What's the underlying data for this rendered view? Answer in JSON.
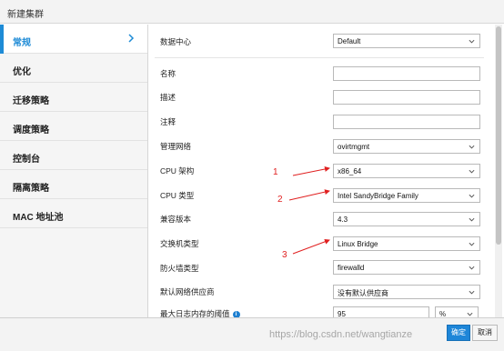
{
  "dialog": {
    "title": "新建集群"
  },
  "sidebar": {
    "items": [
      {
        "label": "常规"
      },
      {
        "label": "优化"
      },
      {
        "label": "迁移策略"
      },
      {
        "label": "调度策略"
      },
      {
        "label": "控制台"
      },
      {
        "label": "隔离策略"
      },
      {
        "label": "MAC 地址池"
      }
    ]
  },
  "form": {
    "datacenter": {
      "label": "数据中心",
      "value": "Default"
    },
    "name": {
      "label": "名称",
      "value": ""
    },
    "description": {
      "label": "描述",
      "value": ""
    },
    "comment": {
      "label": "注释",
      "value": ""
    },
    "mgmt_network": {
      "label": "管理网络",
      "value": "ovirtmgmt"
    },
    "cpu_arch": {
      "label": "CPU 架构",
      "value": "x86_64"
    },
    "cpu_type": {
      "label": "CPU 类型",
      "value": "Intel SandyBridge Family"
    },
    "compat_version": {
      "label": "兼容版本",
      "value": "4.3"
    },
    "switch_type": {
      "label": "交换机类型",
      "value": "Linux Bridge"
    },
    "firewall_type": {
      "label": "防火墙类型",
      "value": "firewalld"
    },
    "net_provider": {
      "label": "默认网络供应商",
      "value": "没有默认供应商"
    },
    "max_log_memory": {
      "label": "最大日志内存的阈值",
      "value": "95",
      "unit": "%"
    }
  },
  "annotations": [
    "1",
    "2",
    "3"
  ],
  "footer": {
    "ok_label": "确定",
    "cancel_label": "取消"
  },
  "watermark": "https://blog.csdn.net/wangtianze",
  "colors": {
    "accent": "#1e8bd6",
    "annotation": "#e02020"
  }
}
